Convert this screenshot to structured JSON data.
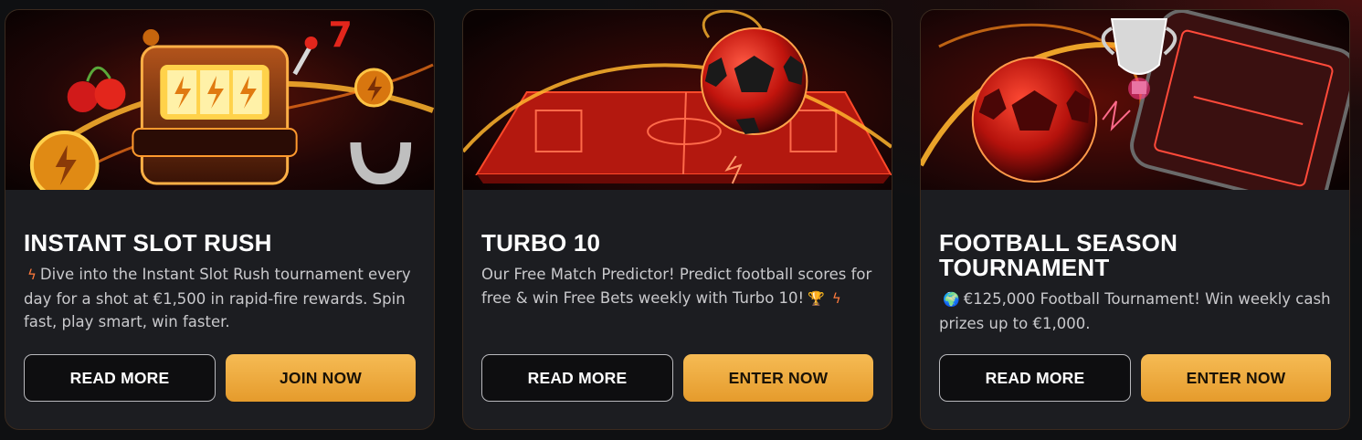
{
  "cards": [
    {
      "title": "INSTANT SLOT RUSH",
      "prefix_icon": "lightning-icon",
      "description": "Dive into the Instant Slot Rush tournament every day for a shot at €1,500 in rapid-fire rewards. Spin fast, play smart, win faster.",
      "read_more": "READ MORE",
      "cta": "JOIN NOW"
    },
    {
      "title": "TURBO 10",
      "description": "Our Free Match Predictor! Predict football scores for free & win Free Bets weekly with Turbo 10!",
      "suffix_icons": [
        "trophy-icon",
        "lightning-icon"
      ],
      "read_more": "READ MORE",
      "cta": "ENTER NOW"
    },
    {
      "title": "FOOTBALL SEASON TOURNAMENT",
      "prefix_icon": "globe-icon",
      "description": "€125,000 Football Tournament! Win weekly cash prizes up to €1,000.",
      "read_more": "READ MORE",
      "cta": "ENTER NOW"
    }
  ],
  "colors": {
    "card_bg": "#1c1d21",
    "page_bg": "#0f1012",
    "gold_button": "#f0ad43",
    "accent_red": "#e3261c",
    "accent_orange": "#ff9a2e"
  }
}
